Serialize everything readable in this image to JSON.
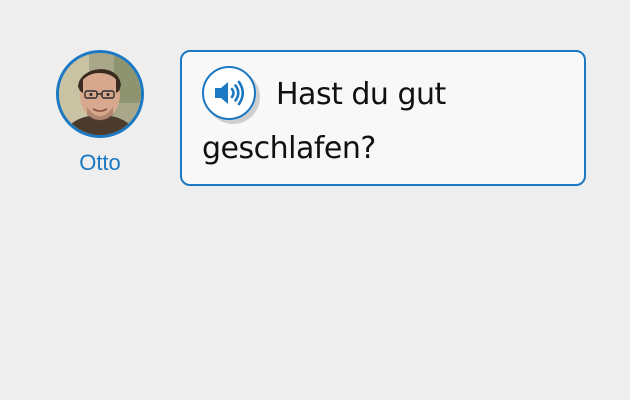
{
  "speaker": {
    "name": "Otto",
    "avatar_icon": "person-portrait"
  },
  "message": {
    "audio_icon": "speaker-volume-icon",
    "text": "Hast du gut geschlafen?"
  },
  "colors": {
    "accent": "#1b78c2",
    "background": "#eeeeee",
    "bubble_background": "#f8f8f8",
    "text": "#111111"
  }
}
